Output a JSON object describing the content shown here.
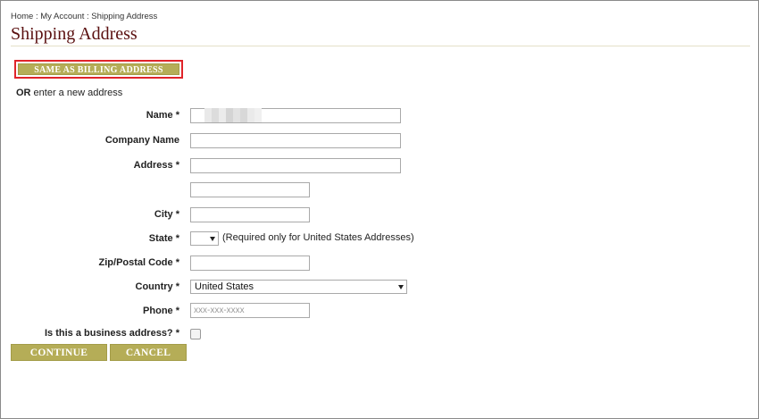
{
  "breadcrumb": {
    "home": "Home",
    "sep1": " : ",
    "account": "My Account",
    "sep2": " : ",
    "current": "Shipping Address"
  },
  "page_title": "Shipping Address",
  "same_as_billing_label": "SAME AS BILLING ADDRESS",
  "or_line": {
    "bold": "OR",
    "rest": " enter a new address"
  },
  "form": {
    "name_label": "Name *",
    "company_label": "Company Name",
    "address_label": "Address *",
    "city_label": "City *",
    "state_label": "State *",
    "state_note": "(Required only for United States Addresses)",
    "zip_label": "Zip/Postal Code *",
    "country_label": "Country *",
    "country_value": "United States",
    "phone_label": "Phone *",
    "phone_placeholder": "xxx-xxx-xxxx",
    "business_label": "Is this a business address? *"
  },
  "buttons": {
    "continue": "CONTINUE",
    "cancel": "CANCEL"
  },
  "colors": {
    "accent": "#b5ad57",
    "title": "#5a0f0f",
    "highlight": "#e0242a"
  }
}
